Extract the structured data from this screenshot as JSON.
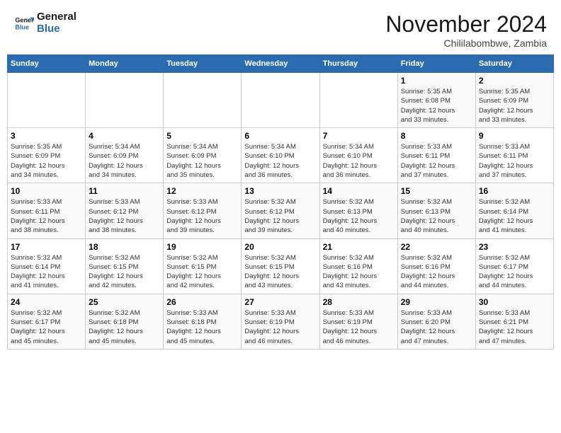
{
  "header": {
    "logo_text_general": "General",
    "logo_text_blue": "Blue",
    "month": "November 2024",
    "location": "Chililabombwe, Zambia"
  },
  "weekdays": [
    "Sunday",
    "Monday",
    "Tuesday",
    "Wednesday",
    "Thursday",
    "Friday",
    "Saturday"
  ],
  "weeks": [
    [
      {
        "day": "",
        "info": ""
      },
      {
        "day": "",
        "info": ""
      },
      {
        "day": "",
        "info": ""
      },
      {
        "day": "",
        "info": ""
      },
      {
        "day": "",
        "info": ""
      },
      {
        "day": "1",
        "info": "Sunrise: 5:35 AM\nSunset: 6:08 PM\nDaylight: 12 hours\nand 33 minutes."
      },
      {
        "day": "2",
        "info": "Sunrise: 5:35 AM\nSunset: 6:09 PM\nDaylight: 12 hours\nand 33 minutes."
      }
    ],
    [
      {
        "day": "3",
        "info": "Sunrise: 5:35 AM\nSunset: 6:09 PM\nDaylight: 12 hours\nand 34 minutes."
      },
      {
        "day": "4",
        "info": "Sunrise: 5:34 AM\nSunset: 6:09 PM\nDaylight: 12 hours\nand 34 minutes."
      },
      {
        "day": "5",
        "info": "Sunrise: 5:34 AM\nSunset: 6:09 PM\nDaylight: 12 hours\nand 35 minutes."
      },
      {
        "day": "6",
        "info": "Sunrise: 5:34 AM\nSunset: 6:10 PM\nDaylight: 12 hours\nand 36 minutes."
      },
      {
        "day": "7",
        "info": "Sunrise: 5:34 AM\nSunset: 6:10 PM\nDaylight: 12 hours\nand 36 minutes."
      },
      {
        "day": "8",
        "info": "Sunrise: 5:33 AM\nSunset: 6:11 PM\nDaylight: 12 hours\nand 37 minutes."
      },
      {
        "day": "9",
        "info": "Sunrise: 5:33 AM\nSunset: 6:11 PM\nDaylight: 12 hours\nand 37 minutes."
      }
    ],
    [
      {
        "day": "10",
        "info": "Sunrise: 5:33 AM\nSunset: 6:11 PM\nDaylight: 12 hours\nand 38 minutes."
      },
      {
        "day": "11",
        "info": "Sunrise: 5:33 AM\nSunset: 6:12 PM\nDaylight: 12 hours\nand 38 minutes."
      },
      {
        "day": "12",
        "info": "Sunrise: 5:33 AM\nSunset: 6:12 PM\nDaylight: 12 hours\nand 39 minutes."
      },
      {
        "day": "13",
        "info": "Sunrise: 5:32 AM\nSunset: 6:12 PM\nDaylight: 12 hours\nand 39 minutes."
      },
      {
        "day": "14",
        "info": "Sunrise: 5:32 AM\nSunset: 6:13 PM\nDaylight: 12 hours\nand 40 minutes."
      },
      {
        "day": "15",
        "info": "Sunrise: 5:32 AM\nSunset: 6:13 PM\nDaylight: 12 hours\nand 40 minutes."
      },
      {
        "day": "16",
        "info": "Sunrise: 5:32 AM\nSunset: 6:14 PM\nDaylight: 12 hours\nand 41 minutes."
      }
    ],
    [
      {
        "day": "17",
        "info": "Sunrise: 5:32 AM\nSunset: 6:14 PM\nDaylight: 12 hours\nand 41 minutes."
      },
      {
        "day": "18",
        "info": "Sunrise: 5:32 AM\nSunset: 6:15 PM\nDaylight: 12 hours\nand 42 minutes."
      },
      {
        "day": "19",
        "info": "Sunrise: 5:32 AM\nSunset: 6:15 PM\nDaylight: 12 hours\nand 42 minutes."
      },
      {
        "day": "20",
        "info": "Sunrise: 5:32 AM\nSunset: 6:15 PM\nDaylight: 12 hours\nand 43 minutes."
      },
      {
        "day": "21",
        "info": "Sunrise: 5:32 AM\nSunset: 6:16 PM\nDaylight: 12 hours\nand 43 minutes."
      },
      {
        "day": "22",
        "info": "Sunrise: 5:32 AM\nSunset: 6:16 PM\nDaylight: 12 hours\nand 44 minutes."
      },
      {
        "day": "23",
        "info": "Sunrise: 5:32 AM\nSunset: 6:17 PM\nDaylight: 12 hours\nand 44 minutes."
      }
    ],
    [
      {
        "day": "24",
        "info": "Sunrise: 5:32 AM\nSunset: 6:17 PM\nDaylight: 12 hours\nand 45 minutes."
      },
      {
        "day": "25",
        "info": "Sunrise: 5:32 AM\nSunset: 6:18 PM\nDaylight: 12 hours\nand 45 minutes."
      },
      {
        "day": "26",
        "info": "Sunrise: 5:33 AM\nSunset: 6:18 PM\nDaylight: 12 hours\nand 45 minutes."
      },
      {
        "day": "27",
        "info": "Sunrise: 5:33 AM\nSunset: 6:19 PM\nDaylight: 12 hours\nand 46 minutes."
      },
      {
        "day": "28",
        "info": "Sunrise: 5:33 AM\nSunset: 6:19 PM\nDaylight: 12 hours\nand 46 minutes."
      },
      {
        "day": "29",
        "info": "Sunrise: 5:33 AM\nSunset: 6:20 PM\nDaylight: 12 hours\nand 47 minutes."
      },
      {
        "day": "30",
        "info": "Sunrise: 5:33 AM\nSunset: 6:21 PM\nDaylight: 12 hours\nand 47 minutes."
      }
    ]
  ]
}
